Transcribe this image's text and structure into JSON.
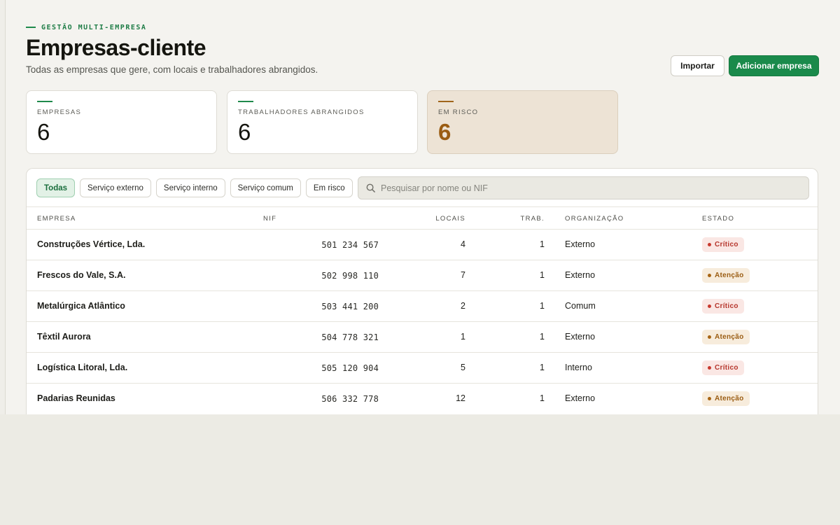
{
  "header": {
    "eyebrow": "GESTÃO MULTI-EMPRESA",
    "title": "Empresas-cliente",
    "subtitle": "Todas as empresas que gere, com locais e trabalhadores abrangidos.",
    "import_label": "Importar",
    "add_label": "Adicionar empresa"
  },
  "stats": [
    {
      "label": "EMPRESAS",
      "value": "6"
    },
    {
      "label": "TRABALHADORES ABRANGIDOS",
      "value": "6"
    },
    {
      "label": "EM RISCO",
      "value": "6"
    }
  ],
  "filters": [
    "Todas",
    "Serviço externo",
    "Serviço interno",
    "Serviço comum",
    "Em risco"
  ],
  "active_filter": "Todas",
  "search": {
    "placeholder": "Pesquisar por nome ou NIF",
    "value": ""
  },
  "table": {
    "columns": [
      "EMPRESA",
      "NIF",
      "LOCAIS",
      "TRAB.",
      "ORGANIZAÇÃO",
      "ESTADO"
    ],
    "rows": [
      {
        "empresa": "Construções Vértice, Lda.",
        "nif": "501 234 567",
        "locais": "4",
        "trab": "1",
        "organizacao": "Externo",
        "estado": "Crítico"
      },
      {
        "empresa": "Frescos do Vale, S.A.",
        "nif": "502 998 110",
        "locais": "7",
        "trab": "1",
        "organizacao": "Externo",
        "estado": "Atenção"
      },
      {
        "empresa": "Metalúrgica Atlântico",
        "nif": "503 441 200",
        "locais": "2",
        "trab": "1",
        "organizacao": "Comum",
        "estado": "Crítico"
      },
      {
        "empresa": "Têxtil Aurora",
        "nif": "504 778 321",
        "locais": "1",
        "trab": "1",
        "organizacao": "Externo",
        "estado": "Atenção"
      },
      {
        "empresa": "Logística Litoral, Lda.",
        "nif": "505 120 904",
        "locais": "5",
        "trab": "1",
        "organizacao": "Interno",
        "estado": "Crítico"
      },
      {
        "empresa": "Padarias Reunidas",
        "nif": "506 332 778",
        "locais": "12",
        "trab": "1",
        "organizacao": "Externo",
        "estado": "Atenção"
      }
    ]
  },
  "colors": {
    "accent": "#1a8a4b",
    "risk": "#9a5c12",
    "critical": "#b5352b",
    "background": "#f4f3ef"
  },
  "icons": {
    "search": "search-icon"
  }
}
